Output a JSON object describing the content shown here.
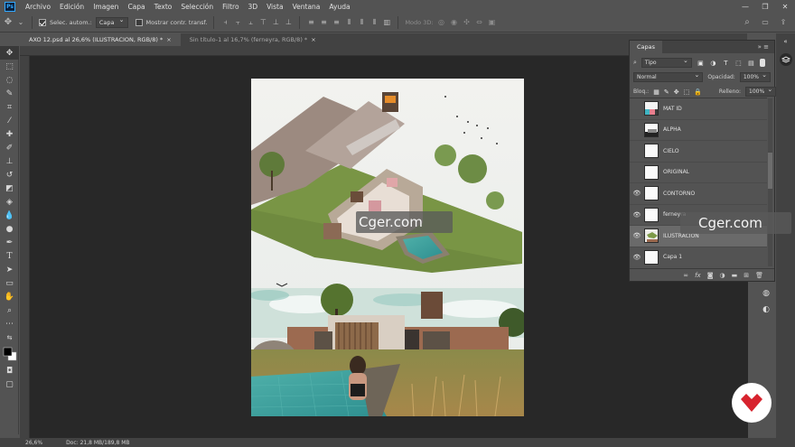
{
  "menubar": {
    "app_icon": "Ps",
    "items": [
      "Archivo",
      "Edición",
      "Imagen",
      "Capa",
      "Texto",
      "Selección",
      "Filtro",
      "3D",
      "Vista",
      "Ventana",
      "Ayuda"
    ],
    "window_controls": [
      "—",
      "❐",
      "✕"
    ]
  },
  "options_bar": {
    "auto_select_label": "Selec. autom.:",
    "auto_select_value": "Capa",
    "transform_controls_label": "Mostrar contr. transf.",
    "mode_3d_label": "Modo 3D:",
    "icons": [
      "move-icon",
      "align-icons",
      "search-icon",
      "workspace-icon",
      "share-icon"
    ]
  },
  "document_tabs": [
    {
      "label": "AXO 12.psd al 26,6% (ILUSTRACION, RGB/8) *",
      "close": "×"
    },
    {
      "label": "Sin título-1 al 16,7% (ferneyra, RGB/8) *",
      "close": "×"
    }
  ],
  "status_bar": {
    "zoom": "26,6%",
    "doc_info": "Doc: 21,8 MB/189,8 MB"
  },
  "layers_panel": {
    "title": "Capas",
    "filter_kind": "Tipo",
    "blend_mode": "Normal",
    "opacity_label": "Opacidad:",
    "opacity_value": "100%",
    "lock_label": "Bloq.:",
    "fill_label": "Relleno:",
    "fill_value": "100%",
    "layers": [
      {
        "name": "MAT ID",
        "visible": false,
        "selected": false,
        "thumb": "matid"
      },
      {
        "name": "ALPHA",
        "visible": false,
        "selected": false,
        "thumb": "alpha"
      },
      {
        "name": "CIELO",
        "visible": false,
        "selected": false,
        "thumb": "plain"
      },
      {
        "name": "ORIGINAL",
        "visible": false,
        "selected": false,
        "thumb": "plain"
      },
      {
        "name": "CONTORNO",
        "visible": true,
        "selected": false,
        "thumb": "plain"
      },
      {
        "name": "ferneyra",
        "visible": true,
        "selected": false,
        "thumb": "plain"
      },
      {
        "name": "ILUSTRACION",
        "visible": true,
        "selected": true,
        "thumb": "illus"
      },
      {
        "name": "Capa 1",
        "visible": true,
        "selected": false,
        "thumb": "plain"
      }
    ],
    "footer_icons": [
      "link-icon",
      "fx-icon",
      "mask-icon",
      "adjustment-icon",
      "folder-icon",
      "new-layer-icon",
      "trash-icon"
    ]
  },
  "watermarks": [
    "Cger.com",
    "Cger.com"
  ],
  "colors": {
    "ui_bg": "#535353",
    "canvas_bg": "#282828",
    "accent": "#31a8ff",
    "selected_layer": "#6a6a6a",
    "logo_red": "#d7232e"
  }
}
